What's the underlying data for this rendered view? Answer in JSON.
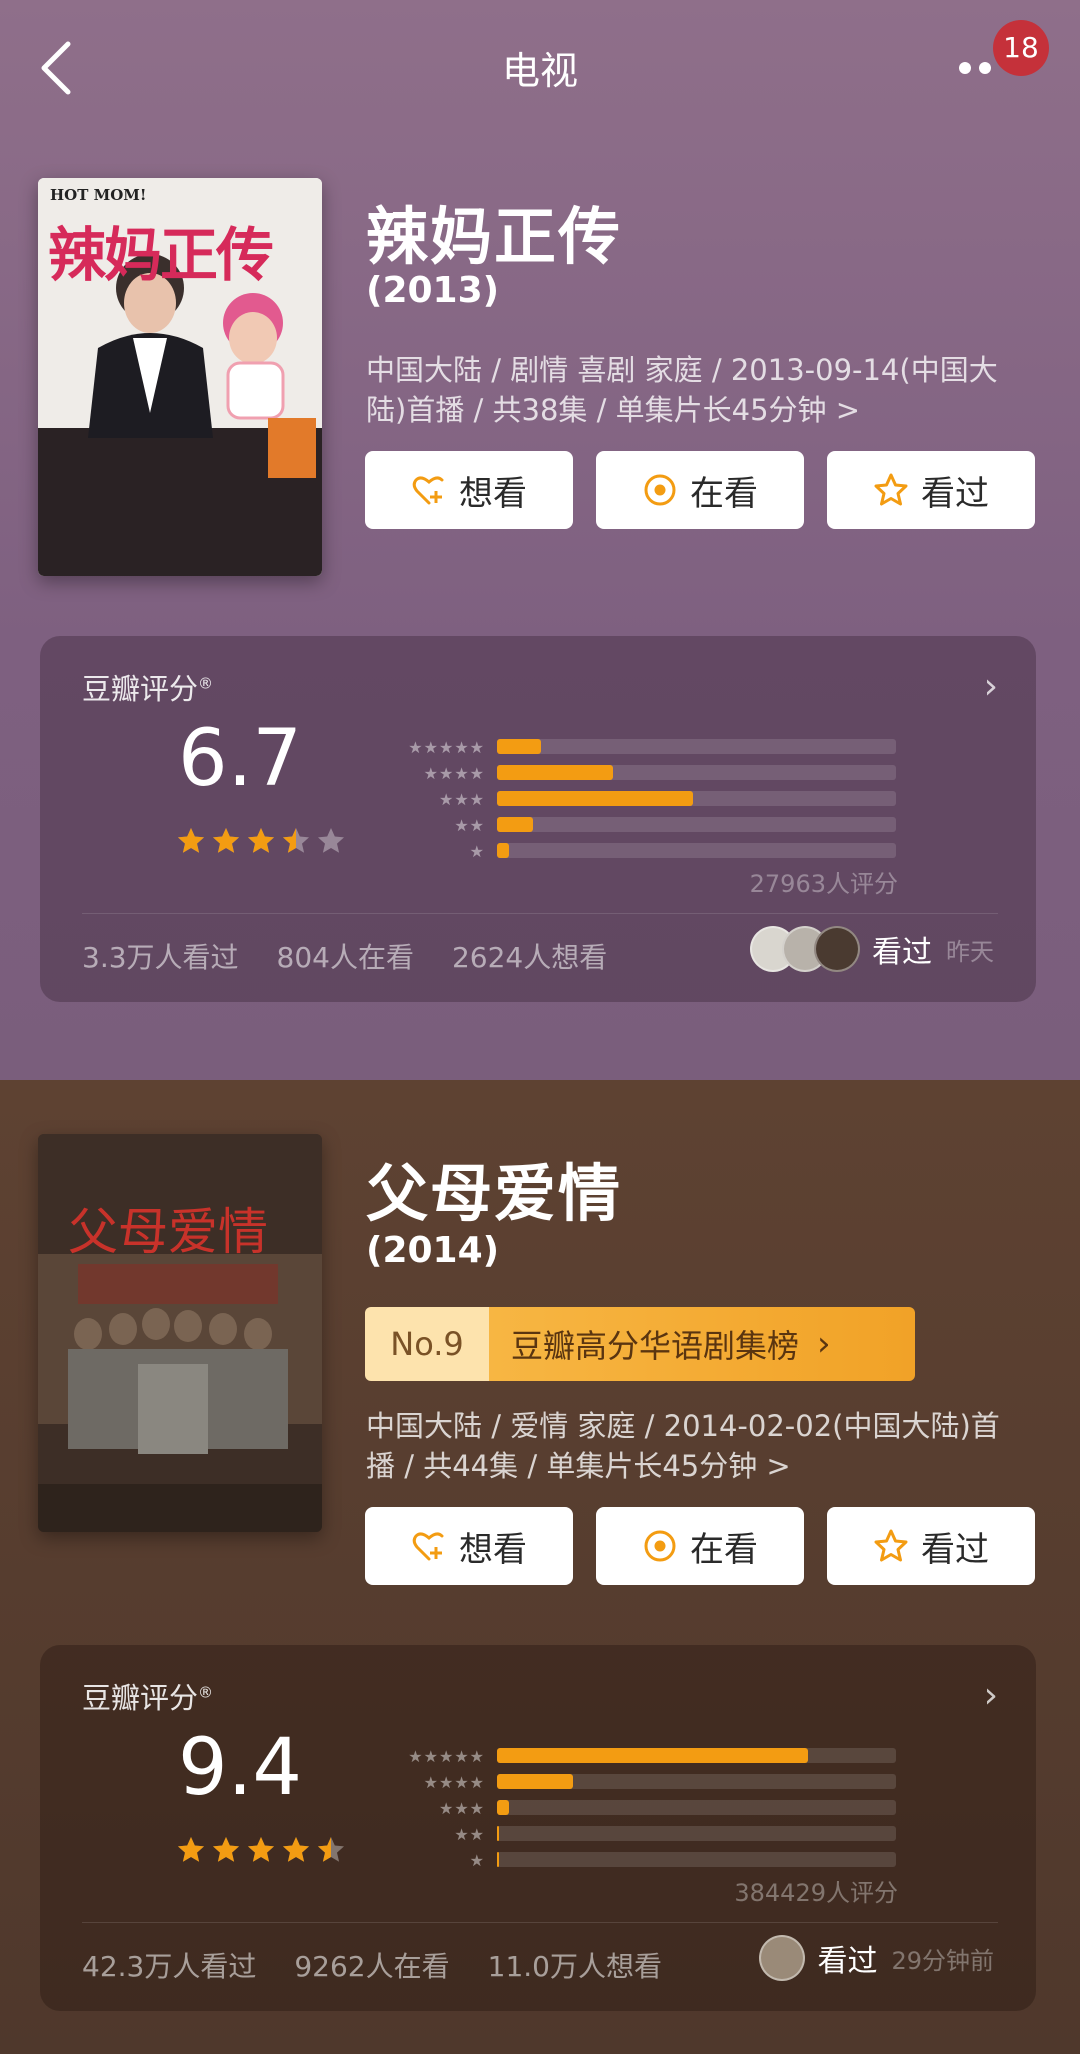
{
  "header": {
    "title": "电视",
    "notification_count": "18"
  },
  "colors": {
    "accent": "#f39c12",
    "section1_bg": "#8f6f8a",
    "section2_bg": "#5e4232"
  },
  "shows": [
    {
      "title": "辣妈正传",
      "year": "(2013)",
      "meta": "中国大陆 / 剧情 喜剧 家庭 / 2013-09-14(中国大陆)首播 / 共38集 / 单集片长45分钟 >",
      "poster_caption": "HOT MOM!",
      "poster_title": "辣妈正传",
      "buttons": {
        "want": "想看",
        "watching": "在看",
        "watched": "看过"
      },
      "rating": {
        "label": "豆瓣评分",
        "score": "6.7",
        "stars": 3.5,
        "distribution": [
          0.11,
          0.29,
          0.49,
          0.09,
          0.03
        ],
        "count": "27963人评分",
        "watched": "3.3万人看过",
        "watching": "804人在看",
        "wish": "2624人想看",
        "friend_action": "看过",
        "friend_time": "昨天"
      }
    },
    {
      "title": "父母爱情",
      "year": "(2014)",
      "rank_no": "No.9",
      "rank_name": "豆瓣高分华语剧集榜",
      "meta": "中国大陆 / 爱情 家庭 / 2014-02-02(中国大陆)首播 / 共44集 / 单集片长45分钟 >",
      "poster_title": "父母爱情",
      "buttons": {
        "want": "想看",
        "watching": "在看",
        "watched": "看过"
      },
      "rating": {
        "label": "豆瓣评分",
        "score": "9.4",
        "stars": 4.5,
        "distribution": [
          0.78,
          0.19,
          0.03,
          0.005,
          0.005
        ],
        "count": "384429人评分",
        "watched": "42.3万人看过",
        "watching": "9262人在看",
        "wish": "11.0万人想看",
        "friend_action": "看过",
        "friend_time": "29分钟前"
      }
    }
  ]
}
